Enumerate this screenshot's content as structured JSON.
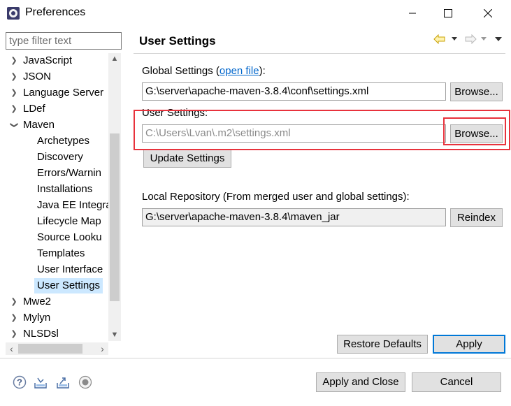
{
  "window": {
    "title": "Preferences",
    "minimize": "—",
    "maximize": "☐",
    "close": "✕"
  },
  "filter": {
    "placeholder": "type filter text"
  },
  "tree": {
    "items": [
      {
        "label": "JavaScript",
        "twisty": "›"
      },
      {
        "label": "JSON",
        "twisty": "›"
      },
      {
        "label": "Language Server",
        "twisty": "›"
      },
      {
        "label": "LDef",
        "twisty": "›"
      },
      {
        "label": "Maven",
        "twisty": "⌄"
      },
      {
        "label": "Archetypes"
      },
      {
        "label": "Discovery"
      },
      {
        "label": "Errors/Warnin"
      },
      {
        "label": "Installations"
      },
      {
        "label": "Java EE Integra"
      },
      {
        "label": "Lifecycle Map"
      },
      {
        "label": "Source Looku"
      },
      {
        "label": "Templates"
      },
      {
        "label": "User Interface"
      },
      {
        "label": "User Settings"
      },
      {
        "label": "Mwe2",
        "twisty": "›"
      },
      {
        "label": "Mylyn",
        "twisty": "›"
      },
      {
        "label": "NLSDsl",
        "twisty": "›"
      }
    ],
    "selected": "User Settings"
  },
  "page": {
    "title": "User Settings",
    "global_label": "Global Settings (",
    "global_link": "open file",
    "global_label_end": "):",
    "global_path": "G:\\server\\apache-maven-3.8.4\\conf\\settings.xml",
    "browse": "Browse...",
    "user_label": "User Settings:",
    "user_path": "C:\\Users\\Lvan\\.m2\\settings.xml",
    "update_settings": "Update Settings",
    "local_repo_label": "Local Repository (From merged user and global settings):",
    "local_repo_path": "G:\\server\\apache-maven-3.8.4\\maven_jar",
    "reindex": "Reindex",
    "restore_defaults": "Restore Defaults",
    "apply": "Apply"
  },
  "footer": {
    "apply_and_close": "Apply and Close",
    "cancel": "Cancel"
  },
  "colors": {
    "selection": "#cce8ff",
    "highlight": "#e8323c",
    "link": "#0066cc",
    "default_button_border": "#0078d7"
  }
}
